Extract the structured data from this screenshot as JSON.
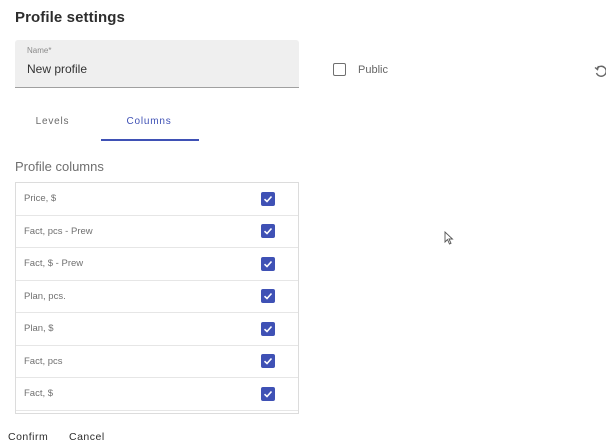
{
  "page": {
    "title": "Profile settings"
  },
  "name_field": {
    "label": "Name*",
    "value": "New profile"
  },
  "public": {
    "label": "Public",
    "checked": false
  },
  "tabs": [
    {
      "label": "Levels",
      "active": false
    },
    {
      "label": "Columns",
      "active": true
    }
  ],
  "columns_section": {
    "title": "Profile columns",
    "items": [
      {
        "label": "Price, $",
        "checked": true
      },
      {
        "label": "Fact, pcs - Prew",
        "checked": true
      },
      {
        "label": "Fact, $ - Prew",
        "checked": true
      },
      {
        "label": "Plan, pcs.",
        "checked": true
      },
      {
        "label": "Plan, $",
        "checked": true
      },
      {
        "label": "Fact, pcs",
        "checked": true
      },
      {
        "label": "Fact, $",
        "checked": true
      }
    ]
  },
  "actions": {
    "confirm_label": "Confirm",
    "cancel_label": "Cancel"
  },
  "icons": {
    "reset": "reset-icon",
    "checkbox_checked": "checkbox-checked-icon",
    "cursor": "mouse-cursor-icon"
  },
  "colors": {
    "accent": "#3f51b5",
    "field_bg": "#efefef"
  }
}
